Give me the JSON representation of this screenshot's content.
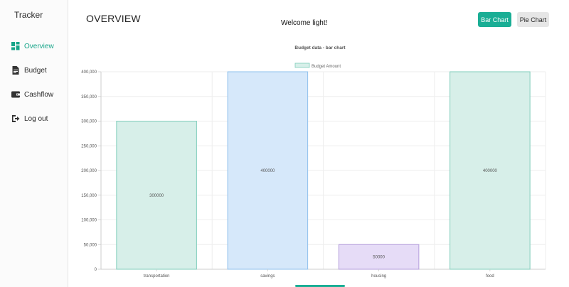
{
  "sidebar": {
    "brand": "Tracker",
    "items": [
      {
        "label": "Overview",
        "icon": "dashboard-icon",
        "active": true
      },
      {
        "label": "Budget",
        "icon": "document-icon",
        "active": false
      },
      {
        "label": "Cashflow",
        "icon": "wallet-icon",
        "active": false
      },
      {
        "label": "Log out",
        "icon": "logout-icon",
        "active": false
      }
    ]
  },
  "header": {
    "title": "OVERVIEW",
    "welcome": "Welcome light!",
    "bar_chart_label": "Bar Chart",
    "pie_chart_label": "Pie Chart"
  },
  "colors": {
    "accent": "#1aae95",
    "bar_teal_fill": "#d7efe9",
    "bar_teal_stroke": "#7fcdbb",
    "bar_blue_fill": "#d6e8fa",
    "bar_blue_stroke": "#8fc0ec",
    "bar_purple_fill": "#e6dcf7",
    "bar_purple_stroke": "#b39ddb"
  },
  "chart_data": {
    "type": "bar",
    "title": "Budget data - bar chart",
    "legend": "Budget Amount",
    "legend_position": "top",
    "categories": [
      "transportation",
      "savings",
      "housing",
      "food"
    ],
    "series": [
      {
        "name": "Budget Amount",
        "values": [
          300000,
          400000,
          50000,
          400000
        ]
      }
    ],
    "data_labels": [
      "300000",
      "400000",
      "50000",
      "400000"
    ],
    "ylim": [
      0,
      400000
    ],
    "yticks": [
      "0",
      "50,000",
      "100,000",
      "150,000",
      "200,000",
      "250,000",
      "300,000",
      "350,000",
      "400,000"
    ],
    "grid": true
  }
}
